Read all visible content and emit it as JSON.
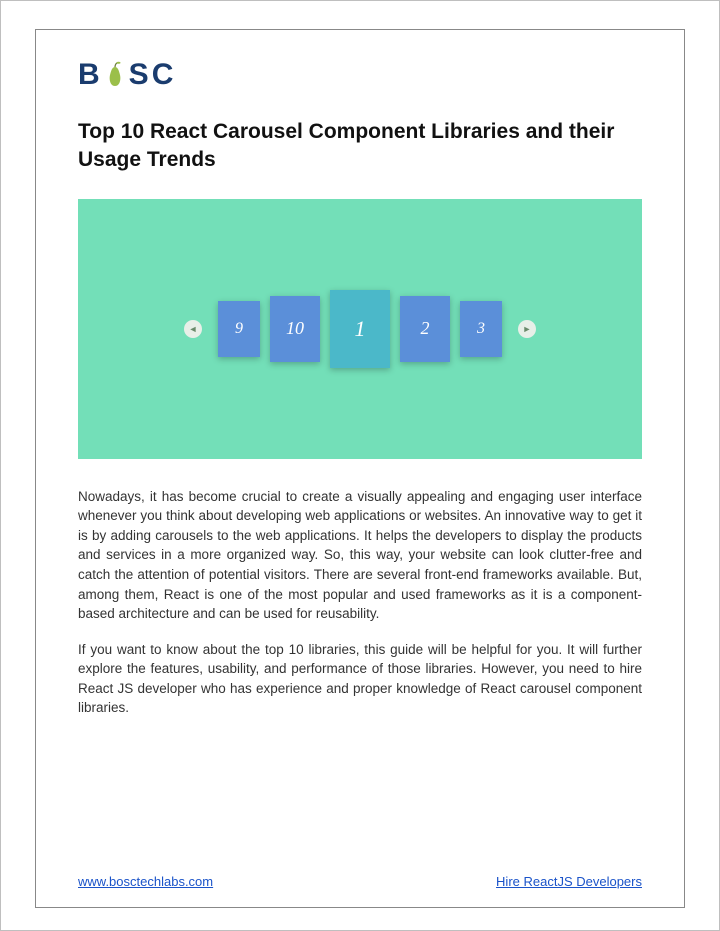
{
  "logo": {
    "b": "B",
    "s": "S",
    "c": "C"
  },
  "title": "Top 10 React Carousel Component Libraries and their Usage Trends",
  "carousel": {
    "prev_glyph": "◄",
    "next_glyph": "►",
    "slides": [
      "9",
      "10",
      "1",
      "2",
      "3"
    ]
  },
  "paragraphs": {
    "p1": "Nowadays, it has become crucial to create a visually appealing and engaging user interface whenever you think about developing web applications or websites. An innovative way to get it is by adding carousels to the web applications. It helps the developers to display the products and services in a more organized way. So, this way, your website can look clutter-free and catch the attention of potential visitors. There are several front-end frameworks available. But, among them, React is one of the most popular and used frameworks as it is a component-based architecture and can be used for reusability.",
    "p2": "If you want to know about the top 10 libraries, this guide will be helpful for you. It will further explore the features, usability, and performance of those libraries. However, you need to hire React JS developer who has experience and proper knowledge of React carousel component libraries."
  },
  "footer": {
    "left_text": "www.bosctechlabs.com",
    "right_text": "Hire ReactJS Developers"
  }
}
